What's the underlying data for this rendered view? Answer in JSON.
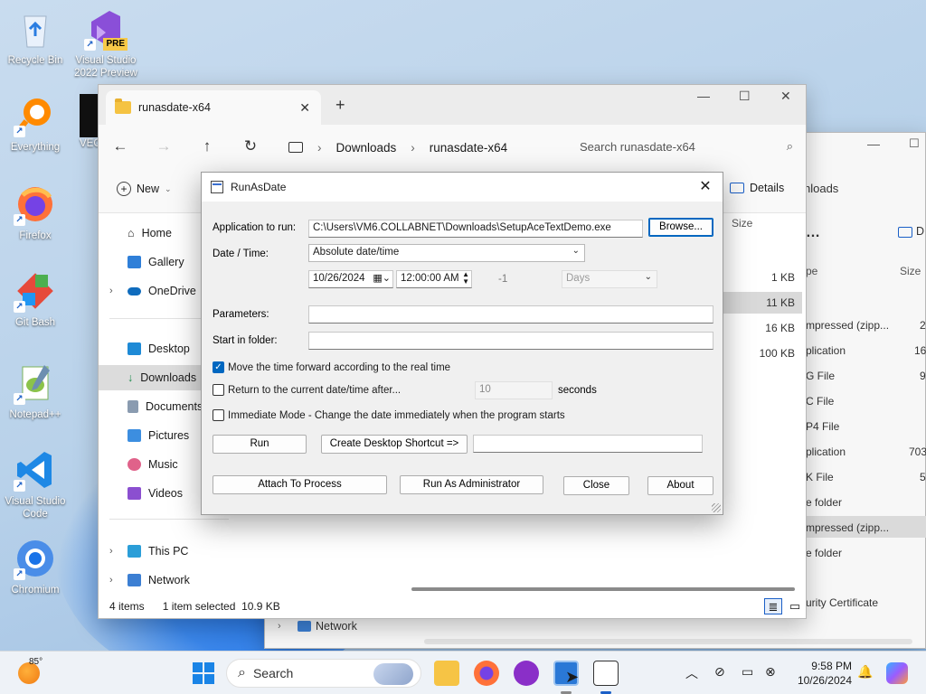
{
  "desktop": {
    "icons": [
      {
        "label": "Recycle Bin"
      },
      {
        "label": "Visual Studio 2022 Preview"
      },
      {
        "label": "Everything"
      },
      {
        "label": "VEC"
      },
      {
        "label": "Firefox"
      },
      {
        "label": "Git Bash"
      },
      {
        "label": "Notepad++"
      },
      {
        "label": "Visual Studio Code"
      },
      {
        "label": "Chromium"
      }
    ],
    "vs_badge": "PRE"
  },
  "explorer_back": {
    "crumb": "nloads",
    "details": "",
    "size_header": "Size",
    "type_header": "pe",
    "rows": [
      {
        "type": "mpressed (zipp...",
        "size": "2"
      },
      {
        "type": "plication",
        "size": "16"
      },
      {
        "type": "G File",
        "size": "9"
      },
      {
        "type": "C File",
        "size": ""
      },
      {
        "type": "P4 File",
        "size": ""
      },
      {
        "type": "plication",
        "size": "703"
      },
      {
        "type": "K File",
        "size": "5"
      },
      {
        "type": "e folder",
        "size": ""
      },
      {
        "type": "mpressed (zipp...",
        "size": ""
      },
      {
        "type": "e folder",
        "size": ""
      },
      {
        "type": "urity Certificate",
        "size": ""
      }
    ],
    "network": "Network",
    "right_clip": "D"
  },
  "explorer": {
    "tab_title": "runasdate-x64",
    "breadcrumb": [
      "Downloads",
      "runasdate-x64"
    ],
    "search_placeholder": "Search runasdate-x64",
    "new_label": "New",
    "details_label": "Details",
    "size_header": "Size",
    "sizes": [
      "1 KB",
      "11 KB",
      "16 KB",
      "100 KB"
    ],
    "sidebar": {
      "home": "Home",
      "gallery": "Gallery",
      "onedrive": "OneDrive",
      "desktop": "Desktop",
      "downloads": "Downloads",
      "documents": "Documents",
      "pictures": "Pictures",
      "music": "Music",
      "videos": "Videos",
      "thispc": "This PC",
      "network": "Network"
    },
    "status": {
      "items": "4 items",
      "selected": "1 item selected",
      "size": "10.9 KB"
    }
  },
  "dialog": {
    "title": "RunAsDate",
    "app_label": "Application to run:",
    "app_value": "C:\\Users\\VM6.COLLABNET\\Downloads\\SetupAceTextDemo.exe",
    "browse": "Browse...",
    "datetime_label": "Date / Time:",
    "datetime_mode": "Absolute date/time",
    "date": "10/26/2024",
    "time": "12:00:00 AM",
    "offset": "-1",
    "offset_unit": "Days",
    "params_label": "Parameters:",
    "params_value": "",
    "startin_label": "Start in folder:",
    "startin_value": "",
    "chk_forward": "Move the time forward according to the real time",
    "chk_return": "Return to the current date/time after...",
    "return_seconds": "10",
    "seconds_label": "seconds",
    "chk_immediate": "Immediate Mode - Change the date immediately when the program starts",
    "run": "Run",
    "shortcut": "Create Desktop Shortcut =>",
    "shortcut_name": "",
    "attach": "Attach To Process",
    "run_admin": "Run As Administrator",
    "close": "Close",
    "about": "About",
    "checked": {
      "forward": true,
      "return": false,
      "immediate": false
    }
  },
  "taskbar": {
    "weather": "85°",
    "search": "Search",
    "time": "9:58 PM",
    "date": "10/26/2024"
  }
}
